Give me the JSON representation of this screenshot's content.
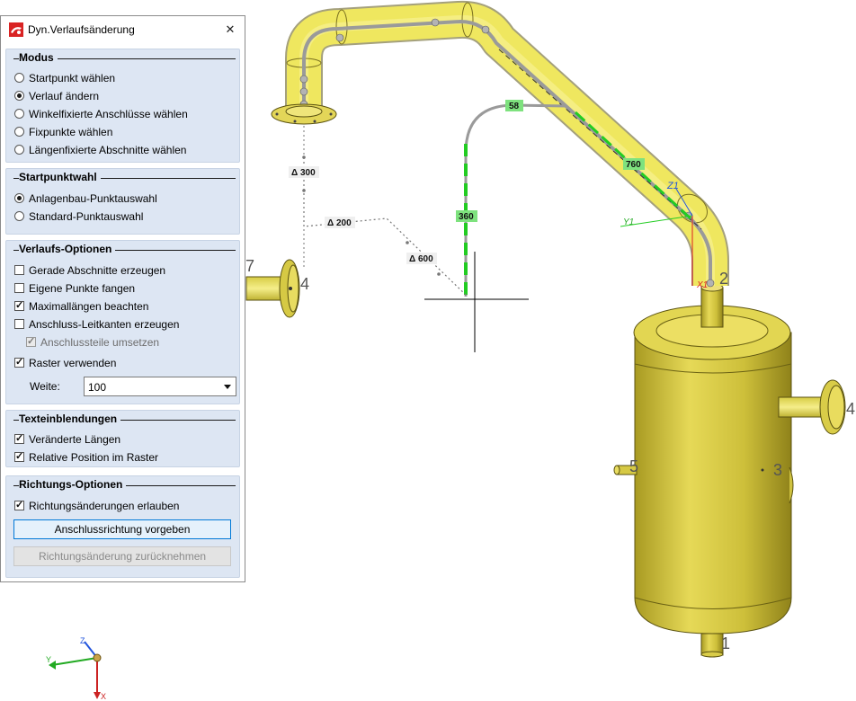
{
  "dialog": {
    "title": "Dyn.Verlaufsänderung",
    "close_label": "✕",
    "modus": {
      "title": "Modus",
      "options": [
        {
          "label": "Startpunkt wählen",
          "selected": false
        },
        {
          "label": "Verlauf ändern",
          "selected": true
        },
        {
          "label": "Winkelfixierte Anschlüsse wählen",
          "selected": false
        },
        {
          "label": "Fixpunkte wählen",
          "selected": false
        },
        {
          "label": "Längenfixierte Abschnitte wählen",
          "selected": false
        }
      ]
    },
    "startpunktwahl": {
      "title": "Startpunktwahl",
      "options": [
        {
          "label": "Anlagenbau-Punktauswahl",
          "selected": true
        },
        {
          "label": "Standard-Punktauswahl",
          "selected": false
        }
      ]
    },
    "verlaufs_optionen": {
      "title": "Verlaufs-Optionen",
      "checks": [
        {
          "label": "Gerade Abschnitte erzeugen",
          "checked": false,
          "enabled": true
        },
        {
          "label": "Eigene Punkte fangen",
          "checked": false,
          "enabled": true
        },
        {
          "label": "Maximallängen beachten",
          "checked": true,
          "enabled": true
        },
        {
          "label": "Anschluss-Leitkanten erzeugen",
          "checked": false,
          "enabled": true
        },
        {
          "label": "Anschlussteile umsetzen",
          "checked": true,
          "enabled": false
        },
        {
          "label": "Raster verwenden",
          "checked": true,
          "enabled": true
        }
      ],
      "weite_label": "Weite:",
      "weite_value": "100"
    },
    "texteinblendungen": {
      "title": "Texteinblendungen",
      "checks": [
        {
          "label": "Veränderte Längen",
          "checked": true
        },
        {
          "label": "Relative Position im Raster",
          "checked": true
        }
      ]
    },
    "richtungs_optionen": {
      "title": "Richtungs-Optionen",
      "checks": [
        {
          "label": "Richtungsänderungen erlauben",
          "checked": true
        }
      ],
      "button_primary": "Anschlussrichtung vorgeben",
      "button_disabled": "Richtungsänderung zurücknehmen"
    }
  },
  "viewport": {
    "dims": {
      "d300": "Δ 300",
      "d200": "Δ 200",
      "d600": "Δ 600"
    },
    "lengths": {
      "l58": "58",
      "l760": "760",
      "l360": "360"
    },
    "nozzles": {
      "n7": "7",
      "n4left": "4",
      "n2": "2",
      "n4right": "4",
      "n5": "5",
      "n3": "3",
      "n1": "1"
    },
    "axis_local": {
      "z1": "Z1",
      "y1": "Y1",
      "x1": "X1"
    },
    "triad": {
      "z": "Z",
      "y": "Y",
      "x": "X"
    },
    "colors": {
      "pipe": "#e6dc5a",
      "vessel": "#ccbf3c",
      "highlight": "#f2f26a",
      "green": "#22cc22",
      "label_green": "#7ee27e"
    }
  }
}
